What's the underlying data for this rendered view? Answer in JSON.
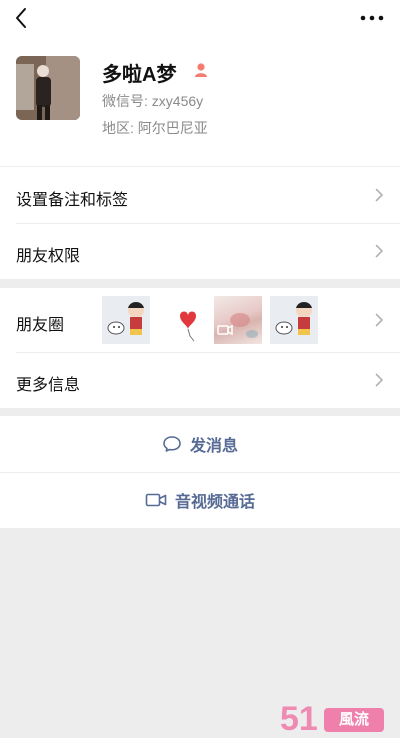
{
  "profile": {
    "name": "多啦A梦",
    "wechat_id_label": "微信号:",
    "wechat_id_value": "zxy456y",
    "region_label": "地区:",
    "region_value": "阿尔巴尼亚"
  },
  "menu1": {
    "remark_tags": "设置备注和标签",
    "friend_permissions": "朋友权限"
  },
  "menu2": {
    "moments": "朋友圈",
    "more_info": "更多信息"
  },
  "actions": {
    "send_message": "发消息",
    "video_call": "音视频通话"
  },
  "watermark": {
    "number": "51",
    "badge": "風流"
  },
  "colors": {
    "link_blue": "#576b95",
    "page_bg": "#ededed",
    "watermark_pink": "#ef7fab"
  }
}
